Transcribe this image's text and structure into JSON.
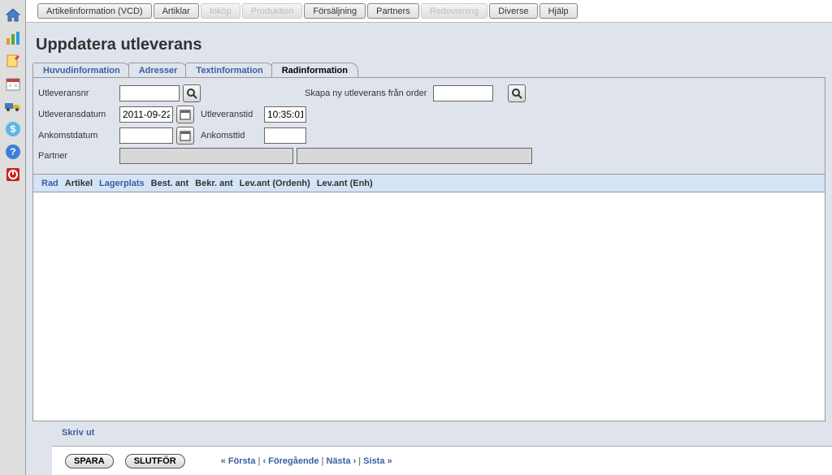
{
  "top_menu": {
    "items": [
      {
        "label": "Artikelinformation (VCD)",
        "disabled": false
      },
      {
        "label": "Artiklar",
        "disabled": false
      },
      {
        "label": "Inköp",
        "disabled": true
      },
      {
        "label": "Produktion",
        "disabled": true
      },
      {
        "label": "Försäljning",
        "disabled": false
      },
      {
        "label": "Partners",
        "disabled": false
      },
      {
        "label": "Redovisning",
        "disabled": true
      },
      {
        "label": "Diverse",
        "disabled": false
      },
      {
        "label": "Hjälp",
        "disabled": false
      }
    ]
  },
  "page": {
    "title": "Uppdatera utleverans"
  },
  "tabs": [
    {
      "label": "Huvudinformation",
      "active": false
    },
    {
      "label": "Adresser",
      "active": false
    },
    {
      "label": "Textinformation",
      "active": false
    },
    {
      "label": "Radinformation",
      "active": true
    }
  ],
  "form": {
    "utleveransnr_label": "Utleveransnr",
    "utleveransnr_value": "",
    "skapa_label": "Skapa ny utleverans från order",
    "skapa_value": "",
    "utleveransdatum_label": "Utleveransdatum",
    "utleveransdatum_value": "2011-09-22",
    "utleveranstid_label": "Utleveranstid",
    "utleveranstid_value": "10:35:01",
    "ankomstdatum_label": "Ankomstdatum",
    "ankomstdatum_value": "",
    "ankomsttid_label": "Ankomsttid",
    "ankomsttid_value": "",
    "partner_label": "Partner",
    "partner_value": "",
    "partner2_value": ""
  },
  "table": {
    "columns": [
      "Rad",
      "Artikel",
      "Lagerplats",
      "Best. ant",
      "Bekr. ant",
      "Lev.ant (Ordenh)",
      "Lev.ant (Enh)"
    ]
  },
  "footer": {
    "print_label": "Skriv ut",
    "save_label": "SPARA",
    "finish_label": "SLUTFÖR",
    "first": "« Första",
    "prev": "‹ Föregående",
    "next": "Nästa ›",
    "last": "Sista »"
  }
}
